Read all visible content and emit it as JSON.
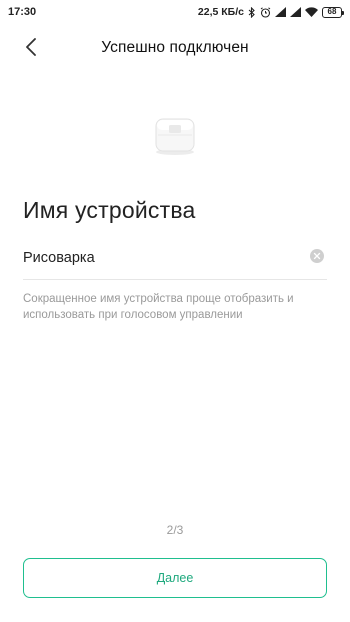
{
  "status_bar": {
    "time": "17:30",
    "network_speed": "22,5 КБ/с",
    "battery_level": "68",
    "icons": [
      "bluetooth-icon",
      "alarm-icon",
      "signal-icon",
      "signal-icon",
      "wifi-icon",
      "battery-icon"
    ]
  },
  "header": {
    "title": "Успешно подключен",
    "back_icon": "chevron-left-icon"
  },
  "device": {
    "icon": "rice-cooker-icon"
  },
  "form": {
    "section_title": "Имя устройства",
    "device_name_value": "Рисоварка",
    "clear_icon": "clear-icon",
    "hint": "Сокращенное имя устройства проще отобразить и использовать при голосовом управлении"
  },
  "footer": {
    "step": "2/3",
    "next_label": "Далее"
  },
  "colors": {
    "accent": "#1fbf8f",
    "hint_text": "#9a9a9a"
  }
}
